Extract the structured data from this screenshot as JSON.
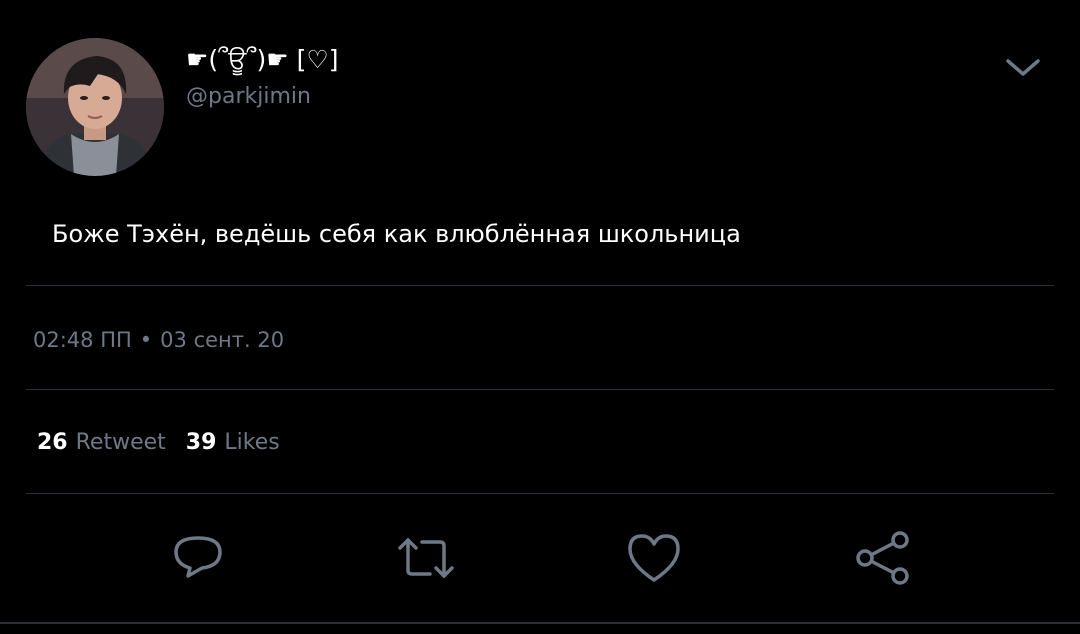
{
  "tweet": {
    "author": {
      "display_name": "☛(՞ਊ՞)☛ [♡]",
      "handle": "@parkjimin"
    },
    "text": "Боже Тэхён, ведёшь себя как влюблённая школьница",
    "meta": {
      "time": "02:48 ПП",
      "separator": "•",
      "date": "03 сент. 20"
    },
    "stats": {
      "retweets_count": "26",
      "retweets_label": "Retweet",
      "likes_count": "39",
      "likes_label": "Likes"
    }
  },
  "icons": {
    "menu": "chevron-down-icon",
    "reply": "reply-icon",
    "retweet": "retweet-icon",
    "like": "heart-icon",
    "share": "share-icon"
  },
  "colors": {
    "background": "#000000",
    "text": "#ffffff",
    "muted": "#6e7886",
    "divider": "#2a2f35",
    "icon": "#6e7886"
  }
}
